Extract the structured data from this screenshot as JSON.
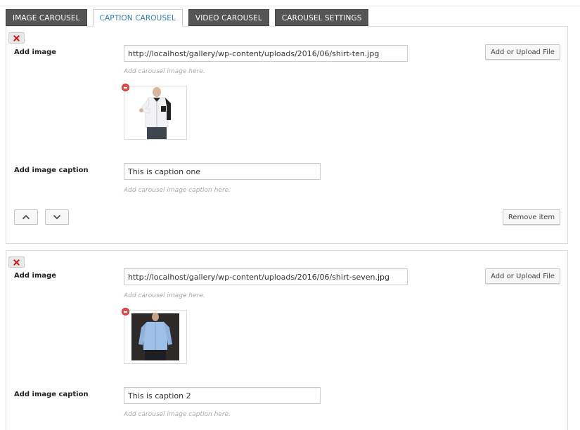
{
  "tabs": [
    {
      "label": "IMAGE CAROUSEL",
      "active": false
    },
    {
      "label": "CAPTION CAROUSEL",
      "active": true
    },
    {
      "label": "VIDEO CAROUSEL",
      "active": false
    },
    {
      "label": "CAROUSEL SETTINGS",
      "active": false
    }
  ],
  "items": [
    {
      "image_label": "Add image",
      "image_url": "http://localhost/gallery/wp-content/uploads/2016/06/shirt-ten.jpg",
      "image_hint": "Add carousel image here.",
      "upload_label": "Add or Upload File",
      "caption_label": "Add image caption",
      "caption_value": "This is caption one",
      "caption_hint": "Add carousel image caption here.",
      "remove_label": "Remove item",
      "thumb_icon": "white-shirt-thumbnail"
    },
    {
      "image_label": "Add image",
      "image_url": "http://localhost/gallery/wp-content/uploads/2016/06/shirt-seven.jpg",
      "image_hint": "Add carousel image here.",
      "upload_label": "Add or Upload File",
      "caption_label": "Add image caption",
      "caption_value": "This is caption 2",
      "caption_hint": "Add carousel image caption here.",
      "thumb_icon": "blue-shirt-thumbnail"
    }
  ],
  "colors": {
    "tab_inactive_bg": "#555555",
    "tab_active_text": "#2e7fb0",
    "delete_icon": "#cc1111"
  }
}
